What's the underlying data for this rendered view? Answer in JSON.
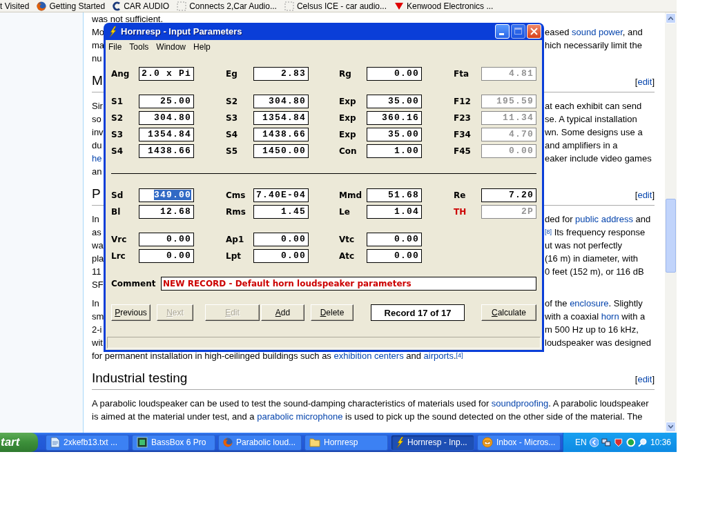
{
  "bookmarks": [
    {
      "label": "t Visited"
    },
    {
      "label": "Getting Started"
    },
    {
      "label": "CAR AUDIO"
    },
    {
      "label": "Connects 2,Car Audio..."
    },
    {
      "label": "Celsus ICE - car audio..."
    },
    {
      "label": "Kenwood Electronics ..."
    }
  ],
  "article": [
    {
      "kind": "paragraph",
      "lines": [
        {
          "left": [
            {
              "text": "was not sufficient."
            }
          ]
        }
      ]
    },
    {
      "kind": "paragraph",
      "lines": [
        {
          "left": [
            {
              "text": "Mo"
            }
          ],
          "right": [
            {
              "text": "eased "
            },
            {
              "link": "sound power"
            },
            {
              "text": ", and"
            }
          ]
        },
        {
          "left": [
            {
              "text": "ma"
            }
          ],
          "right": [
            {
              "text": "hich necessarily limit the"
            }
          ]
        },
        {
          "left": [
            {
              "text": "nu"
            }
          ]
        }
      ]
    },
    {
      "kind": "heading",
      "left": [
        {
          "text": "M"
        }
      ],
      "right": [
        {
          "text": "["
        },
        {
          "link": "edit"
        },
        {
          "text": "]"
        }
      ]
    },
    {
      "kind": "paragraph",
      "lines": [
        {
          "left": [
            {
              "text": "Sir"
            }
          ],
          "right": [
            {
              "text": "at each exhibit can send"
            }
          ]
        },
        {
          "left": [
            {
              "text": "so"
            }
          ],
          "right": [
            {
              "text": "se. A typical installation"
            }
          ]
        },
        {
          "left": [
            {
              "text": "inv"
            }
          ],
          "right": [
            {
              "text": "wn. Some designs use a"
            }
          ]
        },
        {
          "left": [
            {
              "text": "du"
            }
          ],
          "right": [
            {
              "text": "and amplifiers in a"
            }
          ]
        },
        {
          "left": [
            {
              "link": "he"
            }
          ],
          "right": [
            {
              "text": "eaker include video games"
            }
          ]
        },
        {
          "left": [
            {
              "text": "an"
            }
          ]
        }
      ]
    },
    {
      "kind": "heading",
      "left": [
        {
          "text": "P"
        }
      ],
      "right": [
        {
          "text": "["
        },
        {
          "link": "edit"
        },
        {
          "text": "]"
        }
      ]
    },
    {
      "kind": "paragraph",
      "lines": [
        {
          "left": [
            {
              "text": "In"
            }
          ],
          "right": [
            {
              "text": "ded for "
            },
            {
              "link": "public address"
            },
            {
              "text": " and"
            }
          ]
        },
        {
          "left": [
            {
              "text": "as"
            }
          ],
          "right": [
            {
              "link": "$^{[8]}$"
            },
            {
              "text": " Its frequency response"
            }
          ]
        },
        {
          "left": [
            {
              "text": "wa"
            }
          ],
          "right": [
            {
              "text": "ut was not perfectly"
            }
          ]
        },
        {
          "left": [
            {
              "text": "pla"
            }
          ],
          "right": [
            {
              "text": "(16 m) in diameter, with"
            }
          ]
        },
        {
          "left": [
            {
              "text": "11"
            }
          ],
          "right": [
            {
              "text": "0 feet (152 m), or 116 dB"
            }
          ]
        },
        {
          "left": [
            {
              "text": "SF"
            }
          ]
        }
      ]
    },
    {
      "kind": "paragraph",
      "lines": [
        {
          "left": [
            {
              "text": "In"
            }
          ],
          "right": [
            {
              "text": "of the "
            },
            {
              "link": "enclosure"
            },
            {
              "text": ". Slightly"
            }
          ]
        },
        {
          "left": [
            {
              "text": "sm"
            }
          ],
          "right": [
            {
              "text": "with a coaxial "
            },
            {
              "link": "horn"
            },
            {
              "text": " with a"
            }
          ]
        },
        {
          "left": [
            {
              "text": "2-i"
            }
          ],
          "right": [
            {
              "text": "m 500 Hz up to 16 kHz,"
            }
          ]
        },
        {
          "left": [
            {
              "text": "wit"
            }
          ],
          "right": [
            {
              "text": "loudspeaker was designed"
            }
          ]
        },
        {
          "left": [
            {
              "text": "for permanent installation in high-ceilinged buildings such as "
            },
            {
              "link": "exhibition centers"
            },
            {
              "text": " and "
            },
            {
              "link": "airports"
            },
            {
              "text": "."
            },
            {
              "link": "$^{[4]}$"
            }
          ]
        }
      ]
    },
    {
      "kind": "heading",
      "left": [
        {
          "text": "Industrial testing"
        }
      ],
      "right": [
        {
          "text": "["
        },
        {
          "link": "edit"
        },
        {
          "text": "]"
        }
      ]
    },
    {
      "kind": "paragraph",
      "lines": [
        {
          "left": [
            {
              "text": "A parabolic loudspeaker can be used to test the sound-damping characteristics of materials used for "
            },
            {
              "link": "soundproofing"
            },
            {
              "text": ". A parabolic loudspeaker"
            }
          ]
        },
        {
          "left": [
            {
              "text": "is aimed at the material under test, and a "
            },
            {
              "link": "parabolic microphone"
            },
            {
              "text": " is used to pick up the sound detected on the other side of the material. The"
            }
          ]
        }
      ]
    }
  ],
  "dialog": {
    "title": "Hornresp - Input Parameters",
    "menu": [
      "File",
      "Tools",
      "Window",
      "Help"
    ],
    "sections": [
      {
        "kind": "fields",
        "rows": [
          [
            {
              "label": "Ang",
              "value": "2.0 x Pi",
              "disabled": false,
              "selected": false
            },
            {
              "label": "Eg",
              "value": "2.83",
              "disabled": false,
              "selected": false
            },
            {
              "label": "Rg",
              "value": "0.00",
              "disabled": false,
              "selected": false
            },
            {
              "label": "Fta",
              "value": "4.81",
              "disabled": true,
              "selected": false
            }
          ]
        ]
      },
      {
        "kind": "fields",
        "rows": [
          [
            {
              "label": "S1",
              "value": "25.00",
              "disabled": false,
              "selected": false
            },
            {
              "label": "S2",
              "value": "304.80",
              "disabled": false,
              "selected": false
            },
            {
              "label": "Exp",
              "value": "35.00",
              "disabled": false,
              "selected": false
            },
            {
              "label": "F12",
              "value": "195.59",
              "disabled": true,
              "selected": false
            }
          ],
          [
            {
              "label": "S2",
              "value": "304.80",
              "disabled": false,
              "selected": false
            },
            {
              "label": "S3",
              "value": "1354.84",
              "disabled": false,
              "selected": false
            },
            {
              "label": "Exp",
              "value": "360.16",
              "disabled": false,
              "selected": false
            },
            {
              "label": "F23",
              "value": "11.34",
              "disabled": true,
              "selected": false
            }
          ],
          [
            {
              "label": "S3",
              "value": "1354.84",
              "disabled": false,
              "selected": false
            },
            {
              "label": "S4",
              "value": "1438.66",
              "disabled": false,
              "selected": false
            },
            {
              "label": "Exp",
              "value": "35.00",
              "disabled": false,
              "selected": false
            },
            {
              "label": "F34",
              "value": "4.70",
              "disabled": true,
              "selected": false
            }
          ],
          [
            {
              "label": "S4",
              "value": "1438.66",
              "disabled": false,
              "selected": false
            },
            {
              "label": "S5",
              "value": "1450.00",
              "disabled": false,
              "selected": false
            },
            {
              "label": "Con",
              "value": "1.00",
              "disabled": false,
              "selected": false
            },
            {
              "label": "F45",
              "value": "0.00",
              "disabled": true,
              "selected": false
            }
          ]
        ]
      },
      {
        "kind": "divider"
      },
      {
        "kind": "fields",
        "rows": [
          [
            {
              "label": "Sd",
              "value": "349.00",
              "disabled": false,
              "selected": true
            },
            {
              "label": "Cms",
              "value": "7.40E-04",
              "disabled": false,
              "selected": false
            },
            {
              "label": "Mmd",
              "value": "51.68",
              "disabled": false,
              "selected": false
            },
            {
              "label": "Re",
              "value": "7.20",
              "disabled": false,
              "selected": false
            }
          ],
          [
            {
              "label": "Bl",
              "value": "12.68",
              "disabled": false,
              "selected": false
            },
            {
              "label": "Rms",
              "value": "1.45",
              "disabled": false,
              "selected": false
            },
            {
              "label": "Le",
              "value": "1.04",
              "disabled": false,
              "selected": false
            },
            {
              "label": "TH",
              "value": "2P",
              "disabled": true,
              "selected": false,
              "color": "#cc0000"
            }
          ]
        ]
      },
      {
        "kind": "fields",
        "rows": [
          [
            {
              "label": "Vrc",
              "value": "0.00",
              "disabled": false,
              "selected": false
            },
            {
              "label": "Ap1",
              "value": "0.00",
              "disabled": false,
              "selected": false
            },
            {
              "label": "Vtc",
              "value": "0.00",
              "disabled": false,
              "selected": false
            }
          ],
          [
            {
              "label": "Lrc",
              "value": "0.00",
              "disabled": false,
              "selected": false
            },
            {
              "label": "Lpt",
              "value": "0.00",
              "disabled": false,
              "selected": false
            },
            {
              "label": "Atc",
              "value": "0.00",
              "disabled": false,
              "selected": false
            }
          ]
        ]
      }
    ],
    "comment": {
      "label": "Comment",
      "value": "NEW RECORD - Default horn loudspeaker parameters"
    },
    "footer": [
      {
        "kind": "button",
        "label": "Previous",
        "disabled": false
      },
      {
        "kind": "button",
        "label": "Next",
        "disabled": true
      },
      {
        "kind": "button",
        "label": "Edit",
        "disabled": true
      },
      {
        "kind": "button",
        "label": "Add",
        "disabled": false
      },
      {
        "kind": "button",
        "label": "Delete",
        "disabled": false
      },
      {
        "kind": "display",
        "label": "Record 17 of 17"
      },
      {
        "kind": "button",
        "label": "Calculate",
        "disabled": false
      }
    ]
  },
  "taskbar": {
    "start": "tart",
    "tasks": [
      {
        "label": "2xkefb13.txt ...",
        "selected": false
      },
      {
        "label": "BassBox 6 Pro",
        "selected": false
      },
      {
        "label": "Parabolic loud...",
        "selected": false
      },
      {
        "label": "Hornresp",
        "selected": false
      },
      {
        "label": "Hornresp - Inp...",
        "selected": true
      },
      {
        "label": "Inbox - Micros...",
        "selected": false
      }
    ],
    "language": "EN",
    "time": "10:36"
  }
}
